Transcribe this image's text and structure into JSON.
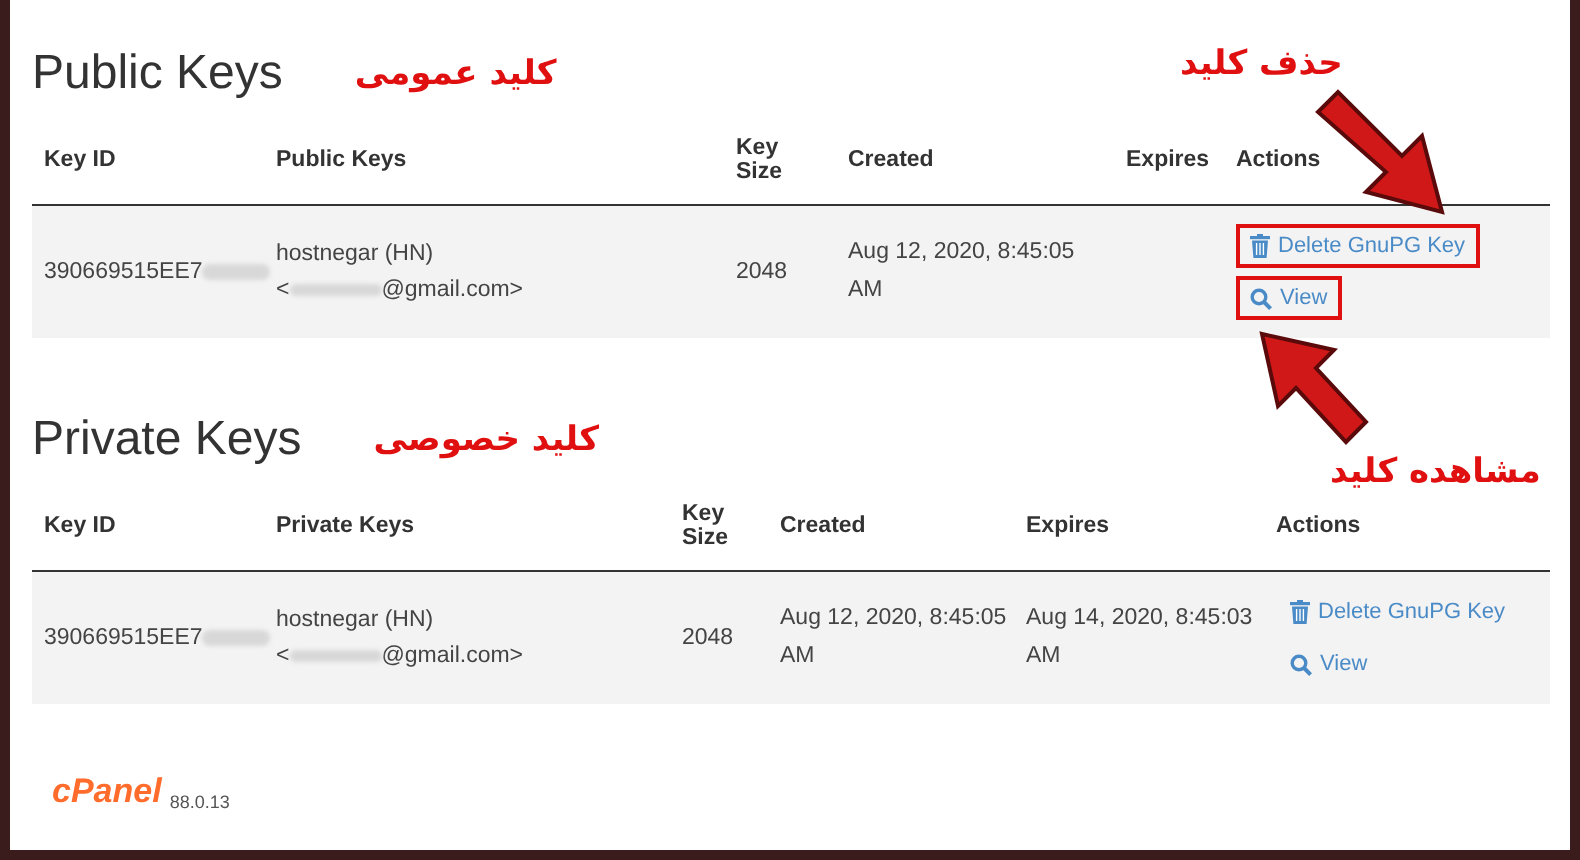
{
  "sections": [
    {
      "title": "Public Keys",
      "annotation": "کلید عمومی",
      "columns": [
        "Key ID",
        "Public Keys",
        "Key Size",
        "Created",
        "Expires",
        "Actions"
      ],
      "rows": [
        {
          "key_id": "390669515EE7",
          "name": "hostnegar (HN)",
          "email_open": "<",
          "email_domain": "@gmail.com>",
          "key_size": "2048",
          "created": "Aug 12, 2020, 8:45:05 AM",
          "actions": [
            {
              "kind": "delete",
              "label": "Delete GnuPG Key",
              "highlighted": true
            },
            {
              "kind": "view",
              "label": "View",
              "highlighted": true
            }
          ]
        }
      ]
    },
    {
      "title": "Private Keys",
      "annotation": "کلید خصوصی",
      "columns": [
        "Key ID",
        "Private Keys",
        "Key Size",
        "Created",
        "Expires",
        "Actions"
      ],
      "rows": [
        {
          "key_id": "390669515EE7",
          "name": "hostnegar (HN)",
          "email_open": "<",
          "email_domain": "@gmail.com>",
          "key_size": "2048",
          "created": "Aug 12, 2020, 8:45:05 AM",
          "expires": "Aug 14, 2020, 8:45:03 AM",
          "actions": [
            {
              "kind": "delete",
              "label": "Delete GnuPG Key",
              "highlighted": false
            },
            {
              "kind": "view",
              "label": "View",
              "highlighted": false
            }
          ]
        }
      ]
    }
  ],
  "callouts": [
    {
      "text": "حذف کلید"
    },
    {
      "text": "مشاهده کلید"
    }
  ],
  "footer": {
    "logo": "cPanel",
    "version": "88.0.13"
  }
}
